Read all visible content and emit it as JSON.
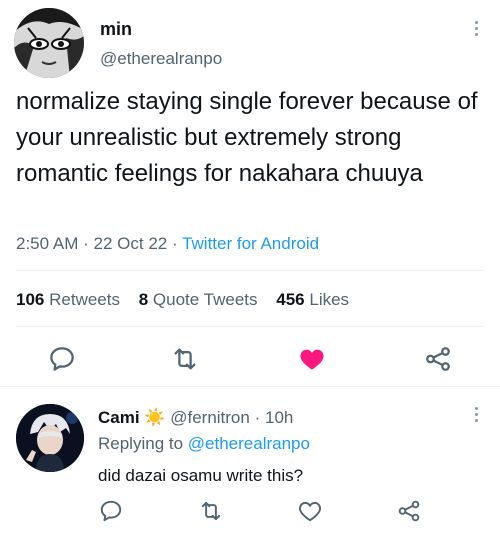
{
  "tweet": {
    "author_name": "min",
    "author_handle": "@etherealranpo",
    "text": "normalize staying single forever because of your unrealistic but extremely strong romantic feelings for nakahara chuuya",
    "time": "2:50 AM",
    "date": "22 Oct 22",
    "source": "Twitter for Android",
    "separator": "·",
    "stats": {
      "retweets_count": "106",
      "retweets_label": "Retweets",
      "quotes_count": "8",
      "quotes_label": "Quote Tweets",
      "likes_count": "456",
      "likes_label": "Likes"
    },
    "liked": true
  },
  "reply": {
    "author_name": "Cami",
    "emoji": "☀️",
    "author_handle": "@fernitron",
    "separator": "·",
    "time": "10h",
    "replying_to_label": "Replying to",
    "replying_to_handle": "@etherealranpo",
    "text": "did dazai osamu write this?"
  },
  "icons": {
    "reply": "comment-icon",
    "retweet": "retweet-icon",
    "like": "heart-icon",
    "share": "share-icon",
    "more": "more-icon"
  },
  "colors": {
    "accent": "#1d9bf0",
    "like": "#f91880",
    "secondary_text": "#536471"
  }
}
